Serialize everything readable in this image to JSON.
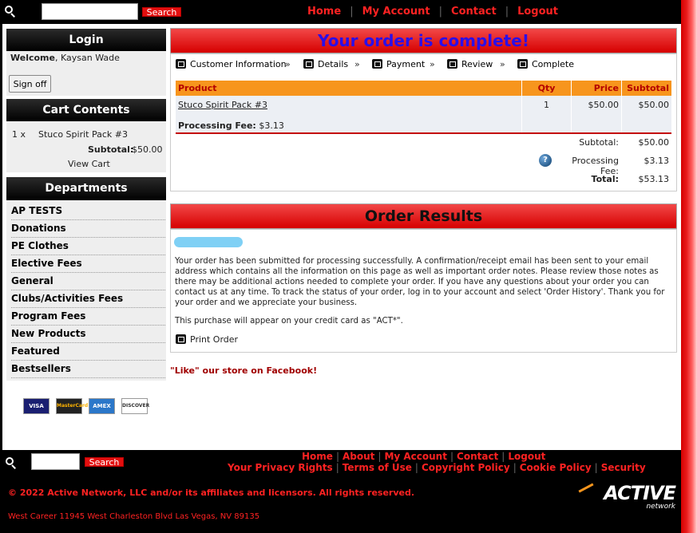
{
  "header": {
    "search_button": "Search",
    "search_value": "",
    "nav": [
      "Home",
      "My Account",
      "Contact",
      "Logout"
    ]
  },
  "login": {
    "title": "Login",
    "welcome_label": "Welcome",
    "user_name": "Kaysan Wade",
    "sign_off": "Sign off"
  },
  "cart": {
    "title": "Cart Contents",
    "qty": "1 x",
    "item": "Stuco Spirit Pack #3",
    "subtotal_label": "Subtotal:",
    "subtotal_value": "$50.00",
    "view_cart": "View Cart"
  },
  "departments": {
    "title": "Departments",
    "items": [
      "AP TESTS",
      "Donations",
      "PE Clothes",
      "Elective Fees",
      "General",
      "Clubs/Activities Fees",
      "Program Fees",
      "New Products",
      "Featured",
      "Bestsellers"
    ]
  },
  "payment_cards": [
    "VISA",
    "MasterCard",
    "AMEX",
    "DISCOVER"
  ],
  "order": {
    "title": "Your order is complete!",
    "steps": [
      "Customer Information",
      "Details",
      "Payment",
      "Review",
      "Complete"
    ],
    "step_separator": "»",
    "table": {
      "headers": [
        "Product",
        "Qty",
        "Price",
        "Subtotal"
      ],
      "product": "Stuco Spirit Pack #3",
      "qty": "1",
      "price": "$50.00",
      "subtotal": "$50.00",
      "fee_label": "Processing Fee:",
      "fee_value": "$3.13"
    },
    "totals": {
      "subtotal_label": "Subtotal:",
      "subtotal_value": "$50.00",
      "fee_label": "Processing Fee:",
      "fee_value": "$3.13",
      "total_label": "Total:",
      "total_value": "$53.13"
    }
  },
  "results": {
    "title": "Order Results",
    "message": "Your order has been submitted for processing successfully. A confirmation/receipt email has been sent to your email address which contains all the information on this page as well as important order notes. Please review those notes as there may be additional actions needed to complete your order. If you have any questions about your order you can contact us at any time. To track the status of your order, log in to your account and select 'Order History'. Thank you for your order and we appreciate your business.",
    "card_note": "This purchase will appear on your credit card as \"ACT*\".",
    "print_order": "Print Order"
  },
  "facebook_link": "\"Like\" our store on Facebook!",
  "footer": {
    "search_button": "Search",
    "nav_row1": [
      "Home",
      "About",
      "My Account",
      "Contact",
      "Logout"
    ],
    "nav_row2": [
      "Your Privacy Rights",
      "Terms of Use",
      "Copyright Policy",
      "Cookie Policy",
      "Security"
    ],
    "copyright": "© 2022 Active Network, LLC and/or its affiliates and licensors. All rights reserved.",
    "address": "West Career 11945 West Charleston Blvd Las Vegas, NV 89135",
    "logo_main": "ACTIVE",
    "logo_sub": "network"
  },
  "colors": {
    "accent_red": "#e30f0f",
    "title_blue": "#2b0fe8",
    "table_header": "#f7951d",
    "footer_bg": "#000000"
  }
}
